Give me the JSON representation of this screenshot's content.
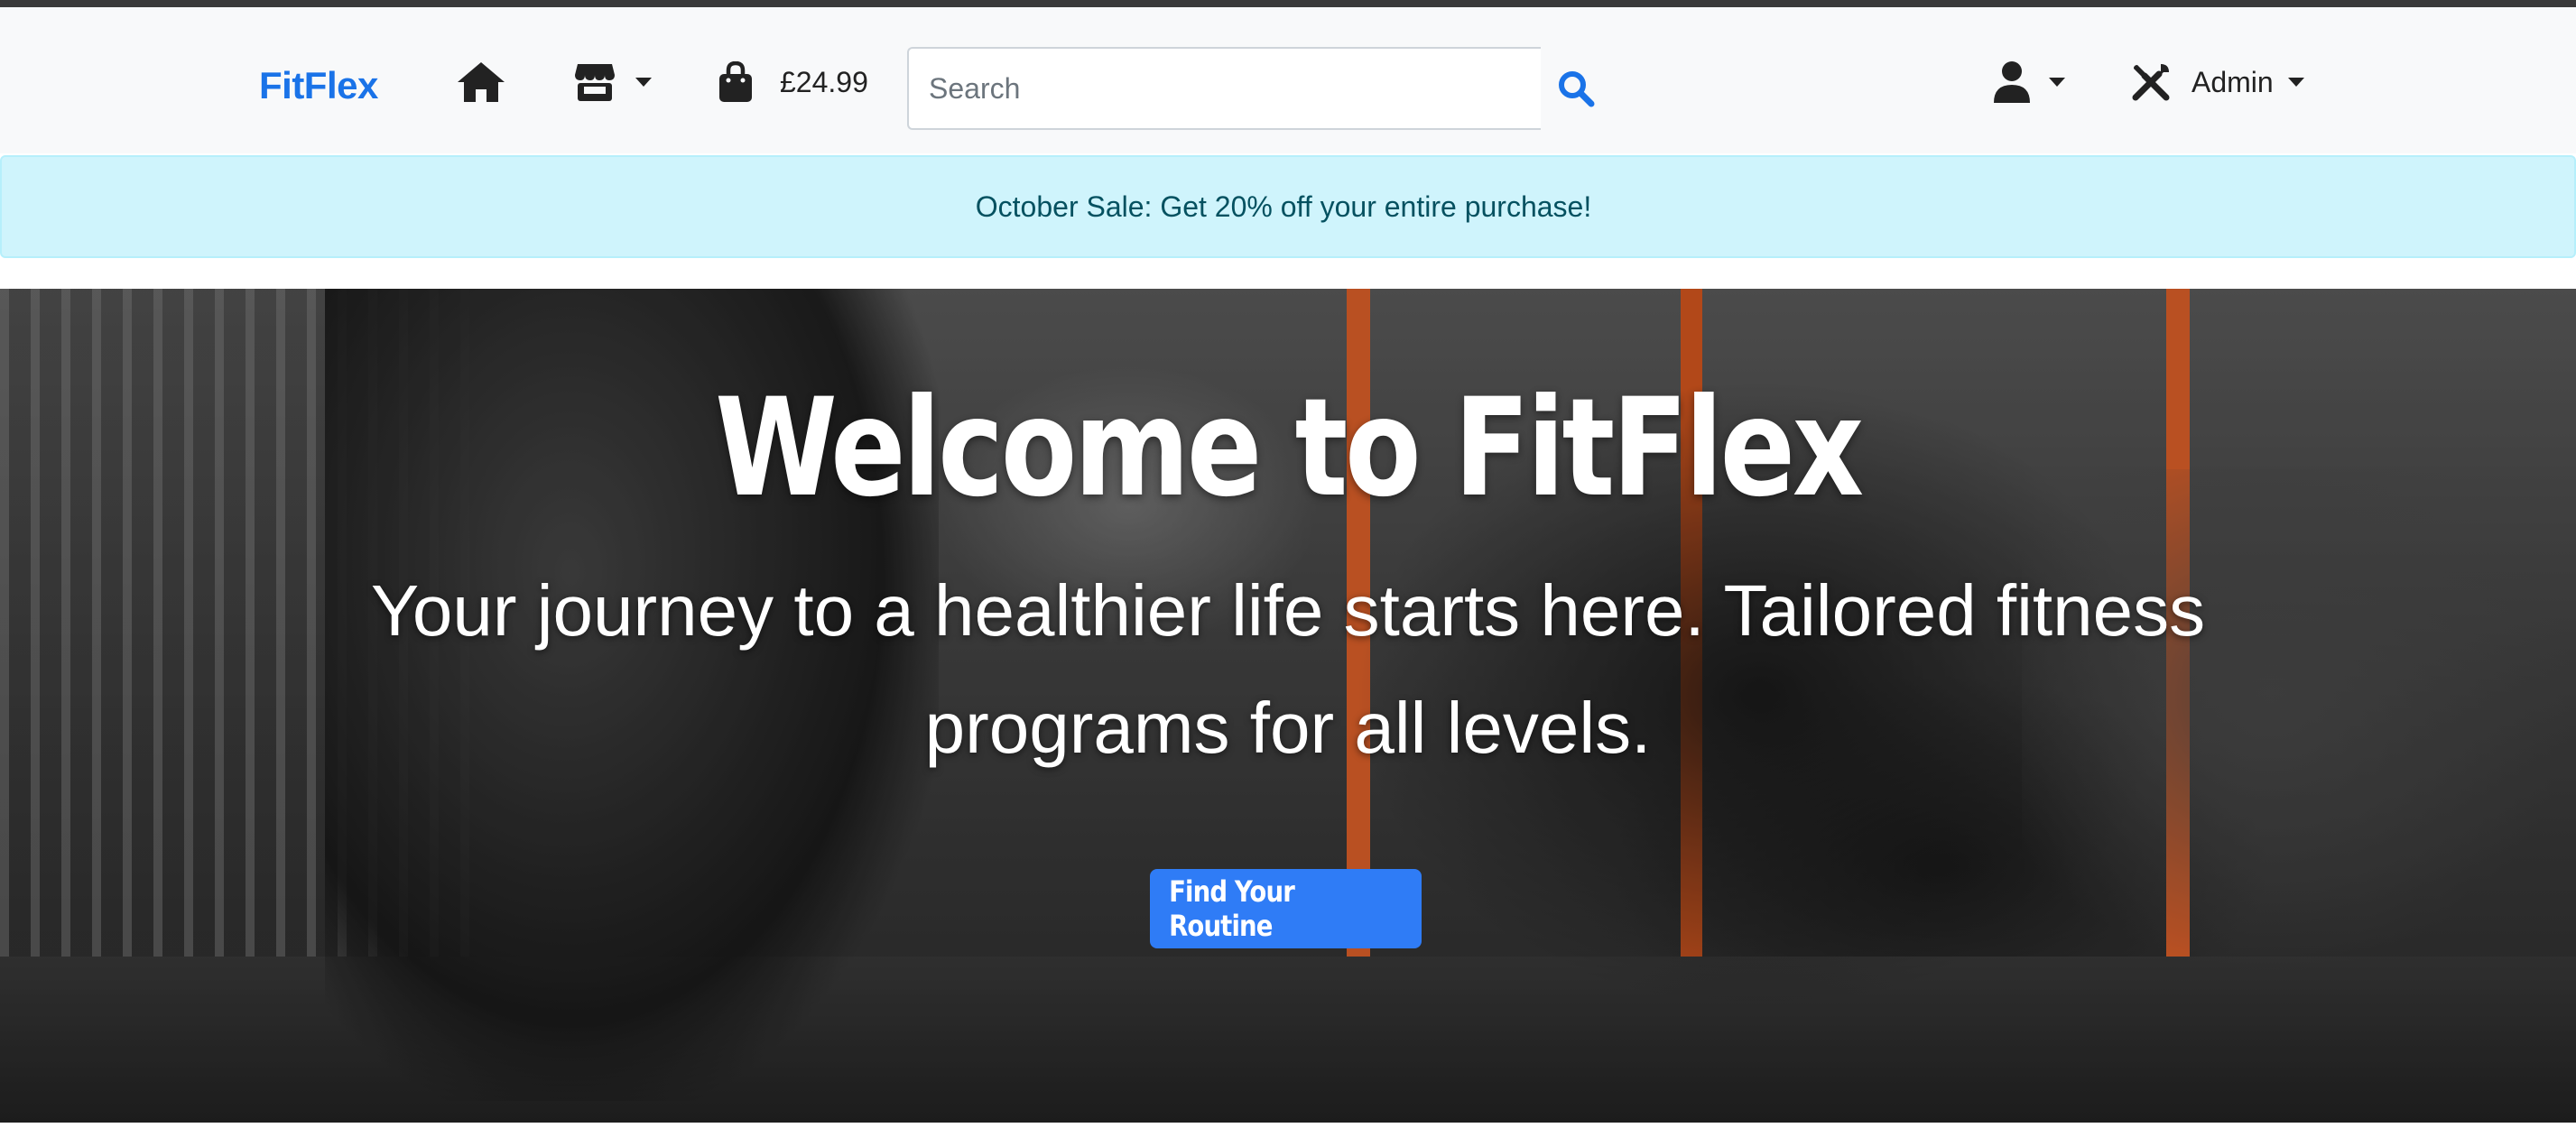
{
  "navbar": {
    "brand": "FitFlex",
    "cart_amount": "£24.99",
    "search": {
      "placeholder": "Search",
      "value": ""
    },
    "admin_label": "Admin"
  },
  "alert": {
    "text": "October Sale: Get 20% off your entire purchase!"
  },
  "hero": {
    "title": "Welcome to FitFlex",
    "subtitle": "Your journey to a healthier life starts here. Tailored fitness programs for all levels.",
    "cta_label": "Find Your Routine"
  },
  "icons": {
    "home": "home-icon",
    "store": "store-icon",
    "bag": "shopping-bag-icon",
    "search": "search-icon",
    "user": "user-icon",
    "admin": "tools-icon"
  },
  "colors": {
    "brand": "#1a73e8",
    "alert_bg": "#cff4fc",
    "alert_text": "#055160",
    "cta": "#2f7cf6",
    "navbar_bg": "#f8f9fa"
  }
}
